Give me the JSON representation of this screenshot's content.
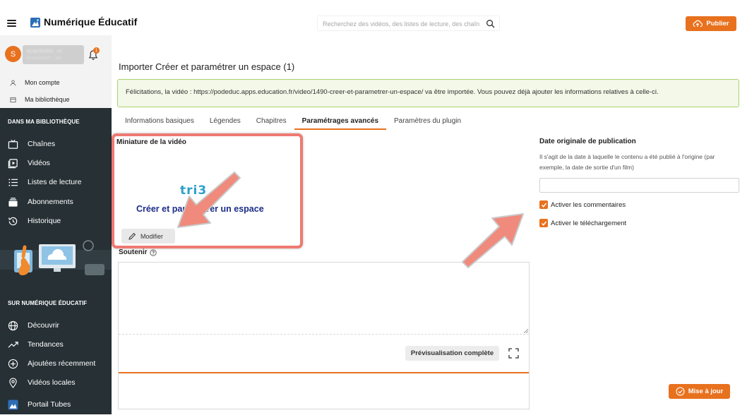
{
  "header": {
    "app_title": "Numérique Éducatif",
    "search_placeholder": "Recherchez des vidéos, des listes de lecture, des chaînes",
    "publish_label": "Publier"
  },
  "user": {
    "avatar_letter": "S",
    "name": "scanledm_vi...",
    "handle": "@scanledm_vid",
    "notification_count": "1"
  },
  "account_links": [
    {
      "label": "Mon compte",
      "icon": "user-icon"
    },
    {
      "label": "Ma bibliothèque",
      "icon": "library-icon"
    }
  ],
  "sidebar": {
    "library_heading": "DANS MA BIBLIOTHÈQUE",
    "library_items": [
      {
        "label": "Chaînes",
        "icon": "tv-icon"
      },
      {
        "label": "Vidéos",
        "icon": "video-icon"
      },
      {
        "label": "Listes de lecture",
        "icon": "list-icon"
      },
      {
        "label": "Abonnements",
        "icon": "inbox-icon"
      },
      {
        "label": "Historique",
        "icon": "history-icon"
      }
    ],
    "site_heading": "SUR NUMÉRIQUE ÉDUCATIF",
    "site_items": [
      {
        "label": "Découvrir",
        "icon": "globe-icon"
      },
      {
        "label": "Tendances",
        "icon": "trending-icon"
      },
      {
        "label": "Ajoutées récemment",
        "icon": "plus-circle-icon"
      },
      {
        "label": "Vidéos locales",
        "icon": "location-icon"
      },
      {
        "label": "Portail Tubes",
        "icon": "portal-icon"
      }
    ]
  },
  "main": {
    "title": "Importer Créer et paramétrer un espace (1)",
    "alert": "Félicitations, la vidéo : https://podeduc.apps.education.fr/video/1490-creer-et-parametrer-un-espace/ va être importée. Vous pouvez déjà ajouter les informations relatives à celle-ci.",
    "tabs": [
      {
        "label": "Informations basiques",
        "active": false
      },
      {
        "label": "Légendes",
        "active": false
      },
      {
        "label": "Chapitres",
        "active": false
      },
      {
        "label": "Paramétrages avancés",
        "active": true
      },
      {
        "label": "Paramètres du plugin",
        "active": false
      }
    ],
    "thumbnail": {
      "label": "Miniature de la vidéo",
      "logo_text": "tri3",
      "caption": "Créer et paramétrer un espace",
      "modify_label": "Modifier"
    },
    "support": {
      "label": "Soutenir",
      "preview_label": "Prévisualisation complète"
    }
  },
  "right": {
    "date_label": "Date originale de publication",
    "date_help": "Il s'agit de la date à laquelle le contenu a été publié à l'origine (par exemple, la date de sortie d'un film)",
    "date_value": "",
    "checkboxes": [
      {
        "label": "Activer les commentaires",
        "checked": true
      },
      {
        "label": "Activer le téléchargement",
        "checked": true
      }
    ],
    "update_label": "Mise à jour"
  },
  "colors": {
    "accent": "#e8711e",
    "sidebar_bg": "#263035",
    "highlight": "#ee7a72",
    "alert_border": "#a9d26c",
    "alert_bg": "#f3f8e8"
  }
}
